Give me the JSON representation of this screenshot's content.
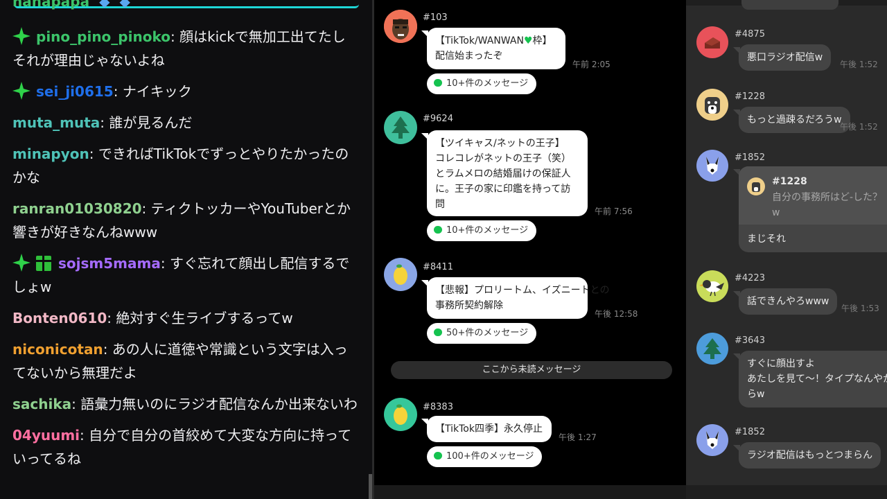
{
  "chat": {
    "cut_username": "nanapapa",
    "messages": [
      {
        "user": "pino_pino_pinoko",
        "sep": ": ",
        "text": "顔はkickで無加工出てたしそれが理由じゃないよね",
        "color": "#3cc46a",
        "badges": [
          "star"
        ]
      },
      {
        "user": "sei_ji0615",
        "sep": ": ",
        "text": "ナイキック",
        "color": "#1f6feb",
        "badges": [
          "star"
        ]
      },
      {
        "user": "muta_muta",
        "sep": ": ",
        "text": "誰が見るんだ",
        "color": "#4fc3b8",
        "badges": []
      },
      {
        "user": "minapyon",
        "sep": ": ",
        "text": "できればTikTokでずっとやりたかったのかな",
        "color": "#4fc3b8",
        "badges": []
      },
      {
        "user": "ranran01030820",
        "sep": ": ",
        "text": "ティクトッカーやYouTuberとか響きが好きなんねwww",
        "color": "#8fd18f",
        "badges": []
      },
      {
        "user": "sojsm5mama",
        "sep": ": ",
        "text": "すぐ忘れて顔出し配信するでしょw",
        "color": "#a56bff",
        "badges": [
          "star",
          "gift"
        ]
      },
      {
        "user": "Bonten0610",
        "sep": ": ",
        "text": "絶対すぐ生ライブするってw",
        "color": "#f2b8c6",
        "badges": []
      },
      {
        "user": "niconicotan",
        "sep": ": ",
        "text": "あの人に道徳や常識という文字は入ってないから無理だよ",
        "color": "#f0a030",
        "badges": []
      },
      {
        "user": "sachika",
        "sep": ": ",
        "text": "語彙力無いのにラジオ配信なんか出来ないわ",
        "color": "#8fd18f",
        "badges": []
      },
      {
        "user": "04yuumi",
        "sep": ": ",
        "text": "自分で自分の首絞めて大変な方向に持っていってるね",
        "color": "#ff6fa0",
        "badges": []
      }
    ]
  },
  "threads": {
    "unread_divider": "ここから未読メッセージ",
    "items": [
      {
        "num": "#103",
        "lines": [
          "【TikTok/WANWAN",
          "枠】",
          "配信始まったぞ"
        ],
        "heart_color": "#15c24f",
        "time": "午前 2:05",
        "replies": "10+件のメッセージ"
      },
      {
        "num": "#9624",
        "lines": [
          "【ツイキャス/ネットの王子】",
          "コレコレがネットの王子（笑）",
          "とラムメロの結婚届けの保証人",
          "に。王子の家に印鑑を持って訪",
          "問"
        ],
        "time": "午前 7:56",
        "replies": "10+件のメッセージ"
      },
      {
        "num": "#8411",
        "lines": [
          "【悲報】プロリートム、イズニートとの",
          "事務所契約解除"
        ],
        "time": "午後 12:58",
        "replies": "50+件のメッセージ"
      },
      {
        "num": "#8383",
        "lines": [
          "【TikTok四季】永久停止"
        ],
        "time": "午後 1:27",
        "replies": "100+件のメッセージ"
      }
    ]
  },
  "detail": {
    "items": [
      {
        "num": "#4875",
        "lines": [
          "悪口ラジオ配信w"
        ],
        "time": "午後 1:52"
      },
      {
        "num": "#1228",
        "lines": [
          "もっと過疎るだろうw"
        ],
        "time": "午後 1:52"
      },
      {
        "num": "#1852",
        "quote_num": "#1228",
        "quote_text": "自分の事務所はど-した？w",
        "reply": "まじそれ"
      },
      {
        "num": "#4223",
        "lines": [
          "話できんやろwww"
        ],
        "time": "午後 1:53"
      },
      {
        "num": "#3643",
        "lines": [
          "すぐに顔出すよ",
          "あたしを見て〜！タイプなんやか",
          "らw"
        ]
      },
      {
        "num": "#1852",
        "lines": [
          "ラジオ配信はもっとつまらん"
        ]
      }
    ]
  }
}
